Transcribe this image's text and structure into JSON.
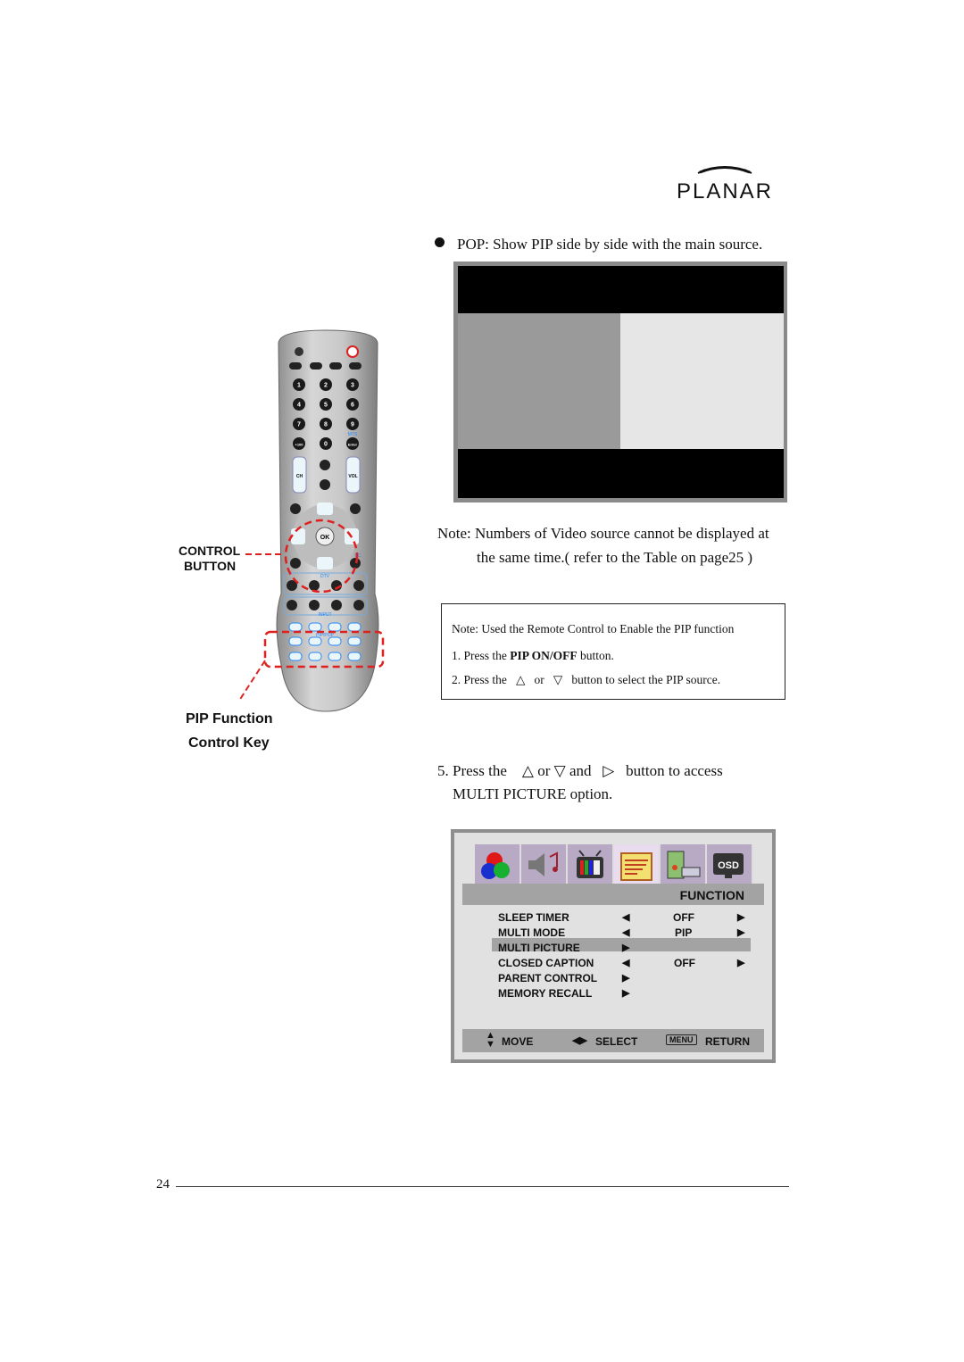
{
  "logo": {
    "text": "PLANAR"
  },
  "pop_bullet": "POP: Show PIP side by side with the main source.",
  "note_main": {
    "line1": "Note: Numbers of Video source cannot be displayed at",
    "line2": "the same time.( refer to the Table on page25 )"
  },
  "note_box": {
    "title": "Note: Used the Remote Control to Enable the PIP function",
    "step1_prefix": "1. Press the ",
    "step1_bold": "PIP ON/OFF",
    "step1_suffix": " button.",
    "step2_prefix": "2. Press the",
    "up": "△",
    "or": "or",
    "down": "▽",
    "step2_suffix": "button to select the PIP source."
  },
  "step5": {
    "prefix": "5. Press the",
    "up": "△",
    "or": "or",
    "down": "▽",
    "and": "and",
    "right": "▷",
    "suffix": "button to access",
    "line2": "MULTI PICTURE option."
  },
  "remote": {
    "control_label_1": "CONTROL",
    "control_label_2": "BUTTON",
    "pip_label_1": "PIP Function",
    "pip_label_2": "Control Key",
    "keys": {
      "ch": "CH",
      "vol": "VOL",
      "ok": "OK",
      "dtv": "DTV",
      "input": "INPUT",
      "pip_pop": "PIP/POP",
      "mts": "MTS",
      "cc": "CC",
      "numbers": [
        "1",
        "2",
        "3",
        "4",
        "5",
        "6",
        "7",
        "8",
        "9",
        "+100",
        "0",
        "Enter"
      ]
    },
    "highlight_color": "#e0201e"
  },
  "osd": {
    "tabs": [
      "color-icon",
      "audio-icon",
      "tv-icon",
      "function-icon",
      "setup-icon",
      "osd-icon"
    ],
    "active_tab": 3,
    "section_title": "FUNCTION",
    "items": [
      {
        "label": "SLEEP TIMER",
        "value": "OFF",
        "left": "◀",
        "right": "▶"
      },
      {
        "label": "MULTI MODE",
        "value": "PIP",
        "left": "◀",
        "right": "▶"
      },
      {
        "label": "MULTI PICTURE",
        "value": "",
        "left": "▶",
        "right": "",
        "selected": true
      },
      {
        "label": "CLOSED CAPTION",
        "value": "OFF",
        "left": "◀",
        "right": "▶"
      },
      {
        "label": "PARENT CONTROL",
        "value": "",
        "left": "▶",
        "right": ""
      },
      {
        "label": "MEMORY RECALL",
        "value": "",
        "left": "▶",
        "right": ""
      }
    ],
    "footer": {
      "move": "MOVE",
      "select": "SELECT",
      "menu_key": "MENU",
      "return": "RETURN"
    }
  },
  "page_number": "24"
}
